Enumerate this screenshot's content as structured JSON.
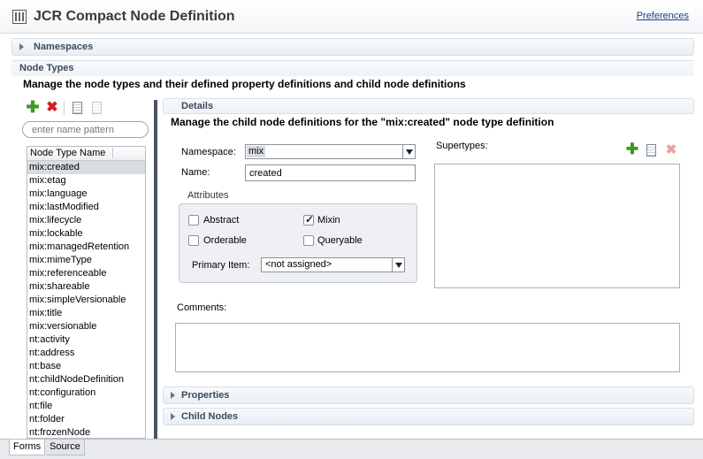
{
  "window": {
    "title": "JCR Compact Node Definition",
    "preferences_link": "Preferences"
  },
  "sections": {
    "namespaces": "Namespaces",
    "node_types": "Node Types",
    "node_types_description": "Manage the node types and their defined property definitions and child node definitions",
    "details": "Details",
    "details_description": "Manage the child node definitions for the \"mix:created\" node type definition",
    "properties": "Properties",
    "child_nodes": "Child Nodes"
  },
  "toolbar": {
    "icons": [
      "add-icon",
      "delete-icon",
      "copy-icon",
      "paste-icon"
    ],
    "add_color": "#3a9a23",
    "delete_color": "#d42020"
  },
  "search": {
    "placeholder": "enter name pattern",
    "value": ""
  },
  "node_type_table": {
    "column_header": "Node Type Name",
    "selected": "mix:created",
    "rows": [
      "mix:created",
      "mix:etag",
      "mix:language",
      "mix:lastModified",
      "mix:lifecycle",
      "mix:lockable",
      "mix:managedRetention",
      "mix:mimeType",
      "mix:referenceable",
      "mix:shareable",
      "mix:simpleVersionable",
      "mix:title",
      "mix:versionable",
      "nt:activity",
      "nt:address",
      "nt:base",
      "nt:childNodeDefinition",
      "nt:configuration",
      "nt:file",
      "nt:folder",
      "nt:frozenNode"
    ]
  },
  "details": {
    "namespace_label": "Namespace:",
    "namespace_value": "mix",
    "name_label": "Name:",
    "name_value": "created",
    "attributes_label": "Attributes",
    "attributes": {
      "abstract": {
        "label": "Abstract",
        "checked": false
      },
      "mixin": {
        "label": "Mixin",
        "checked": true
      },
      "orderable": {
        "label": "Orderable",
        "checked": false
      },
      "queryable": {
        "label": "Queryable",
        "checked": false
      }
    },
    "primary_item_label": "Primary Item:",
    "primary_item_value": "<not assigned>",
    "supertypes_label": "Supertypes:",
    "supertypes": [],
    "comments_label": "Comments:",
    "comments_value": ""
  },
  "tabs": [
    "Forms",
    "Source"
  ],
  "active_tab": "Forms"
}
